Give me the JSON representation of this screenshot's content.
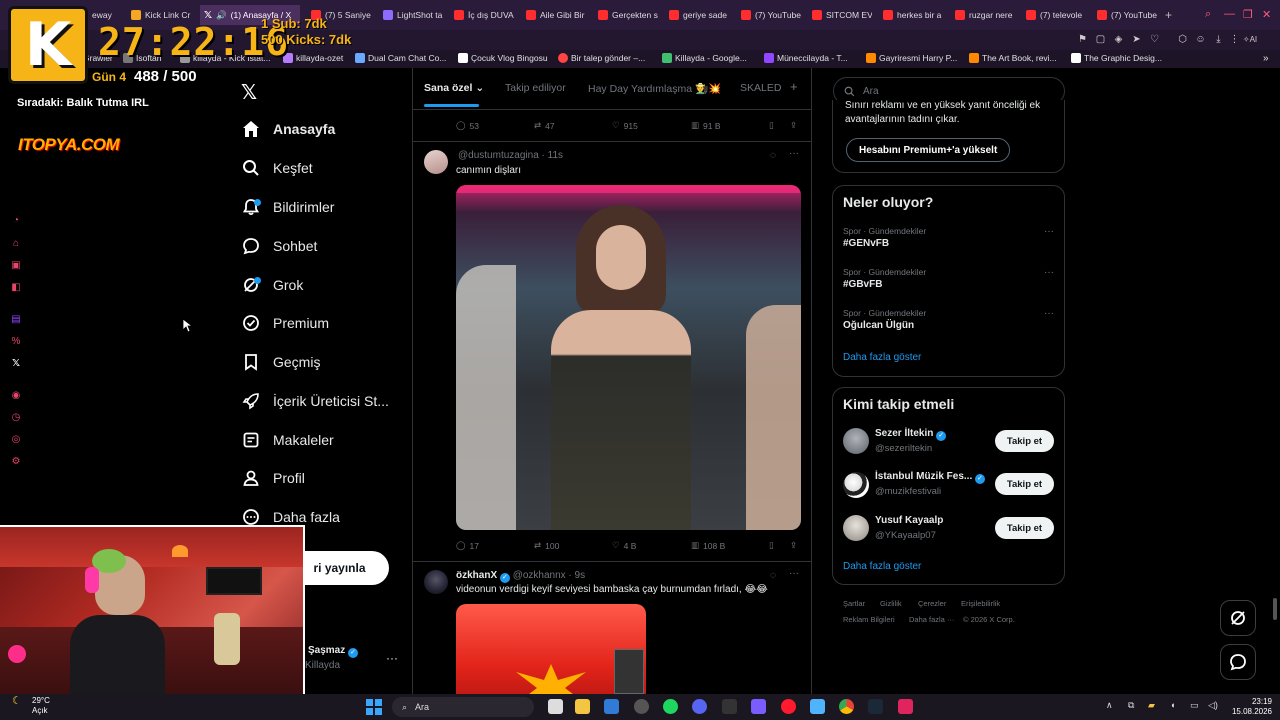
{
  "browser": {
    "tabs": [
      {
        "label": "eway",
        "color": "#888888"
      },
      {
        "label": "Kick Link Cr",
        "color": "#f5a623"
      },
      {
        "label": "(1) Anasayfa / X",
        "color": "#ffffff",
        "active": true
      },
      {
        "label": "(7) 5 Saniye",
        "color": "#ff2d2d"
      },
      {
        "label": "LightShot ta",
        "color": "#8e6bff"
      },
      {
        "label": "İç dış DUVA",
        "color": "#ff2d2d"
      },
      {
        "label": "Aile Gibi Bir",
        "color": "#ff2d2d"
      },
      {
        "label": "Gerçekten s",
        "color": "#ff2d2d"
      },
      {
        "label": "geriye sade",
        "color": "#ff2d2d"
      },
      {
        "label": "(7) YouTube",
        "color": "#ff2d2d"
      },
      {
        "label": "SITCOM EV",
        "color": "#ff2d2d"
      },
      {
        "label": "herkes bir a",
        "color": "#ff2d2d"
      },
      {
        "label": "ruzgar nere",
        "color": "#ff2d2d"
      },
      {
        "label": "(7) televole",
        "color": "#ff2d2d"
      },
      {
        "label": "(7) YouTube",
        "color": "#ff2d2d"
      }
    ],
    "bookmarks": [
      {
        "label": "Grawler",
        "color": "#555555"
      },
      {
        "label": "Isoftan",
        "color": "#777777"
      },
      {
        "label": "killayda - Kick İstat...",
        "color": "#999999"
      },
      {
        "label": "killayda-ozet",
        "color": "#b57cff"
      },
      {
        "label": "Dual Cam Chat Co...",
        "color": "#6aa9ff"
      },
      {
        "label": "Çocuk Vlog Bingosu",
        "color": "#ffffff"
      },
      {
        "label": "Bir talep gönder –...",
        "color": "#ff4444"
      },
      {
        "label": "Killayda - Google...",
        "color": "#3fbf6f"
      },
      {
        "label": "Müneccilayda - T...",
        "color": "#9146ff"
      },
      {
        "label": "Gayriresmi Harry P...",
        "color": "#ff8a00"
      },
      {
        "label": "The Art Book, revi...",
        "color": "#ff8a00"
      },
      {
        "label": "The Graphic Desig...",
        "color": "#ffffff"
      }
    ]
  },
  "overlay": {
    "logo_letter": "K",
    "timer": "27:22:16",
    "sub_goal": "1 Sub: 7dk",
    "kick_goal": "500 Kicks: 7dk",
    "day_label": "Gün 4",
    "day_count": "488 / 500",
    "next_up": "Sıradaki: Balık Tutma IRL",
    "sponsor": "ITOPYA.COM"
  },
  "nav": {
    "items": [
      {
        "label": "Anasayfa",
        "icon": "home-icon"
      },
      {
        "label": "Keşfet",
        "icon": "search-icon"
      },
      {
        "label": "Bildirimler",
        "icon": "bell-icon"
      },
      {
        "label": "Sohbet",
        "icon": "chat-icon"
      },
      {
        "label": "Grok",
        "icon": "grok-icon"
      },
      {
        "label": "Premium",
        "icon": "premium-icon"
      },
      {
        "label": "Geçmiş",
        "icon": "bookmark-icon"
      },
      {
        "label": "İçerik Üreticisi St...",
        "icon": "rocket-icon"
      },
      {
        "label": "Makaleler",
        "icon": "article-icon"
      },
      {
        "label": "Profil",
        "icon": "person-icon"
      },
      {
        "label": "Daha fazla",
        "icon": "more-circle-icon"
      }
    ],
    "post_button": "ri yayınla",
    "profile_name": "Şaşmaz",
    "profile_handle": "Killayda"
  },
  "timeline": {
    "tabs": [
      {
        "label": "Sana özel",
        "active": true
      },
      {
        "label": "Takip ediliyor"
      },
      {
        "label": "Hay Day Yardımlaşma 👨‍🌾💥"
      },
      {
        "label": "SKALED"
      }
    ],
    "prev_actions": {
      "replies": "53",
      "reposts": "47",
      "likes": "915",
      "views": "91 B"
    },
    "tweet1": {
      "handle": "@dustumtuzagina",
      "time": "11s",
      "text": "canımın dişları",
      "actions": {
        "replies": "17",
        "reposts": "100",
        "likes": "4 B",
        "views": "108 B"
      }
    },
    "tweet2": {
      "name": "özkhanX",
      "handle": "@ozkhannx",
      "time": "9s",
      "text": "videonun verdigi keyif seviyesi bambaska çay burnumdan fırladı, 😂😂"
    }
  },
  "right": {
    "search_placeholder": "Ara",
    "premium_text_1": "Sınırı reklamı ve en yüksek yanıt önceliği ek",
    "premium_text_2": "avantajlarının tadını çıkar.",
    "premium_button": "Hesabını Premium+'a yükselt",
    "trends_title": "Neler oluyor?",
    "trends": [
      {
        "category": "Spor · Gündemdekiler",
        "name": "#GENvFB"
      },
      {
        "category": "Spor · Gündemdekiler",
        "name": "#GBvFB"
      },
      {
        "category": "Spor · Gündemdekiler",
        "name": "Oğulcan Ülgün"
      }
    ],
    "show_more": "Daha fazla göster",
    "who_title": "Kimi takip etmeli",
    "who": [
      {
        "name": "Sezer İltekin",
        "handle": "@sezeriltekin",
        "color": "#8a8f99"
      },
      {
        "name": "İstanbul Müzik Fes...",
        "handle": "@muzikfestivali",
        "color": "#f0f0f0"
      },
      {
        "name": "Yusuf Kayaalp",
        "handle": "@YKayaalp07",
        "color": "#d8d4cf"
      }
    ],
    "follow_label": "Takip et",
    "footer": [
      "Şartlar",
      "Gizlilik",
      "Çerezler",
      "Erişilebilirlik",
      "Reklam Bilgileri",
      "Daha fazla ···",
      "© 2026 X Corp."
    ]
  },
  "taskbar": {
    "temp": "29°C",
    "weather": "Açık",
    "search": "Ara",
    "time": "23:19",
    "date": "15.08.2026"
  }
}
